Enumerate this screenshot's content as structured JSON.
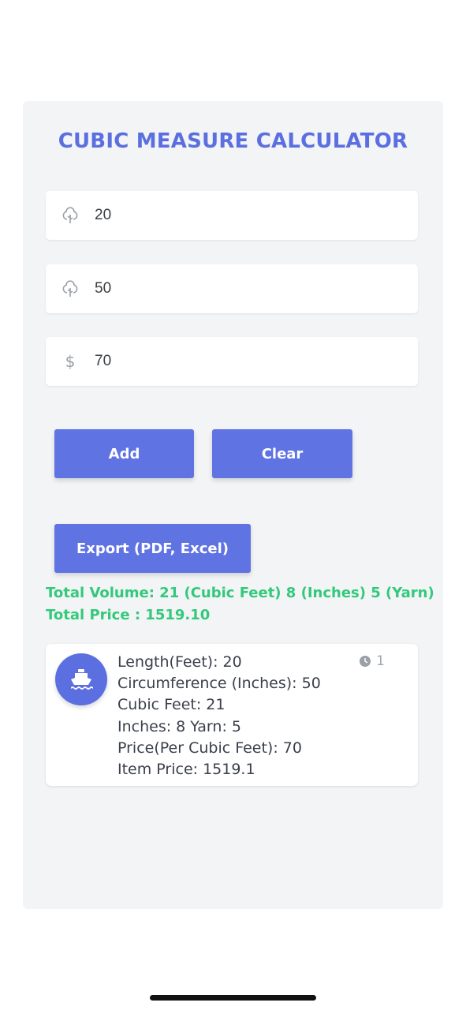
{
  "title": "CUBIC MEASURE CALCULATOR",
  "inputs": [
    {
      "icon": "tree-icon",
      "value": "20"
    },
    {
      "icon": "tree-icon",
      "value": "50"
    },
    {
      "icon": "dollar-icon",
      "value": "70"
    }
  ],
  "buttons": {
    "add": "Add",
    "clear": "Clear",
    "export": "Export (PDF, Excel)"
  },
  "totals": {
    "volume": "Total Volume: 21 (Cubic Feet) 8 (Inches) 5 (Yarn)",
    "price": "Total Price : 1519.10"
  },
  "items": [
    {
      "icon": "ship-icon",
      "lines": [
        "Length(Feet): 20",
        "Circumference (Inches): 50",
        "Cubic Feet: 21",
        "Inches: 8 Yarn: 5",
        "Price(Per Cubic Feet): 70",
        "Item Price: 1519.1"
      ],
      "badge": "1"
    }
  ],
  "colors": {
    "accent": "#6073e3",
    "total": "#33c97a",
    "panel": "#f2f4f6"
  }
}
